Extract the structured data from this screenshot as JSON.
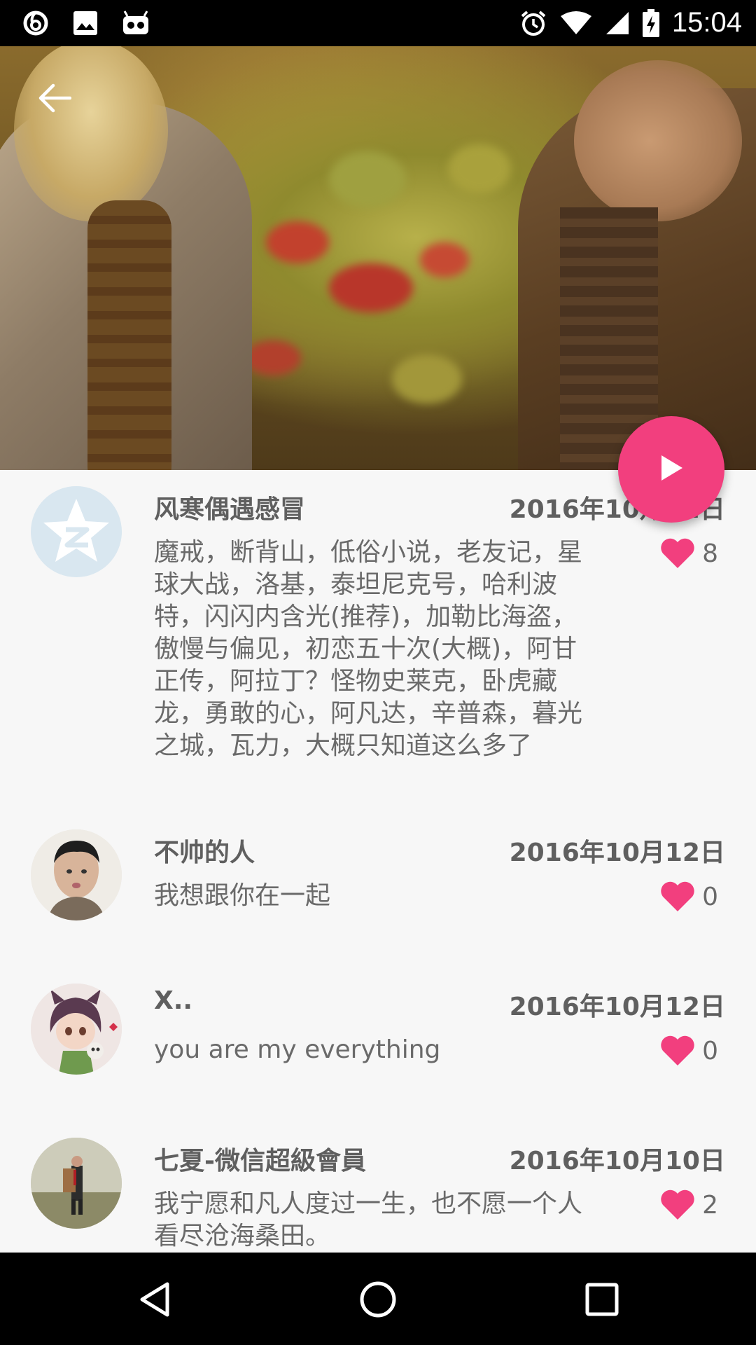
{
  "status_bar": {
    "time": "15:04",
    "left_icons": [
      "netease-music-icon",
      "image-icon",
      "robot-icon"
    ],
    "right_icons": [
      "alarm-icon",
      "wifi-icon",
      "signal-icon",
      "battery-charging-icon"
    ]
  },
  "colors": {
    "fab": "#f23f7e",
    "heart": "#f23f7e",
    "text_primary": "#5f5f5f",
    "text_secondary": "#6a6a6a"
  },
  "comments": [
    {
      "name": "风寒偶遇感冒",
      "date": "2016年10月12日",
      "text": "魔戒，断背山，低俗小说，老友记，星球大战，洛基，泰坦尼克号，哈利波特，闪闪内含光(推荐)，加勒比海盗，傲慢与偏见，初恋五十次(大概)，阿甘正传，阿拉丁？怪物史莱克，卧虎藏龙，勇敢的心，阿凡达，辛普森，暮光之城，瓦力，大概只知道这么多了",
      "likes": "8",
      "avatar": "qzone-logo-avatar"
    },
    {
      "name": "不帅的人",
      "date": "2016年10月12日",
      "text": "我想跟你在一起",
      "likes": "0",
      "avatar": "photo-avatar"
    },
    {
      "name": "X..",
      "date": "2016年10月12日",
      "text": "you are my everything",
      "likes": "0",
      "avatar": "anime-avatar"
    },
    {
      "name": "七夏-微信超級會員",
      "date": "2016年10月10日",
      "text": "我宁愿和凡人度过一生，也不愿一个人看尽沧海桑田。",
      "likes": "2",
      "avatar": "photo-avatar"
    }
  ]
}
